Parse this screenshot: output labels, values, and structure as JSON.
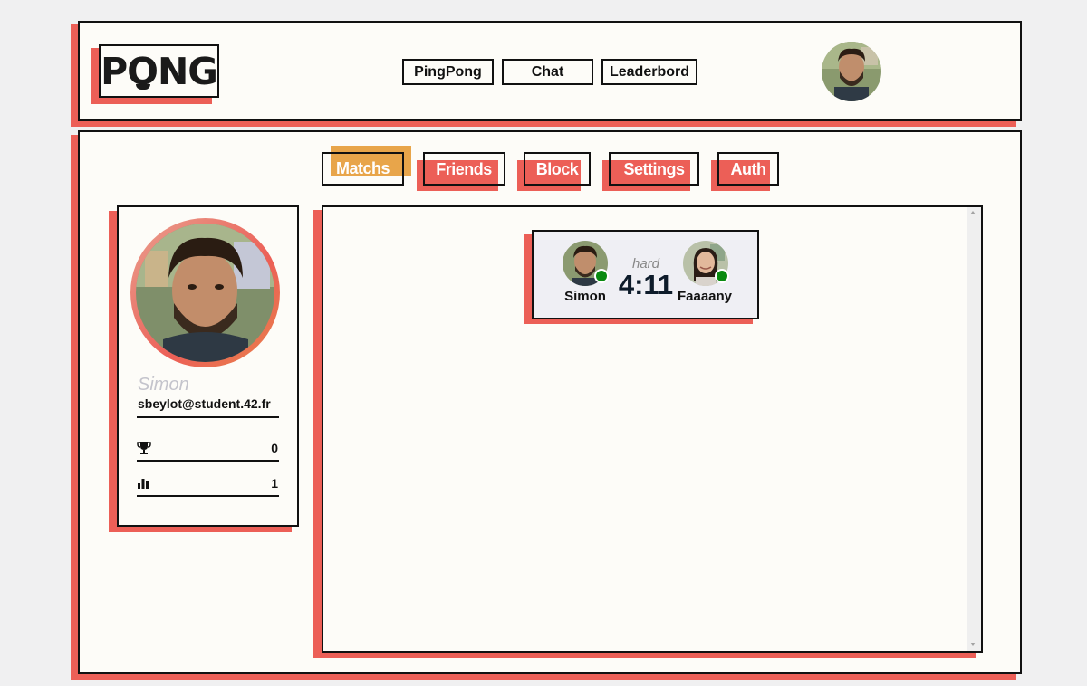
{
  "header": {
    "logo_text": "PONG",
    "nav": [
      {
        "label": "PingPong"
      },
      {
        "label": "Chat"
      },
      {
        "label": "Leaderbord"
      }
    ]
  },
  "tabs": [
    {
      "label": "Matchs",
      "active": true
    },
    {
      "label": "Friends",
      "active": false
    },
    {
      "label": "Block",
      "active": false
    },
    {
      "label": "Settings",
      "active": false
    },
    {
      "label": "Auth",
      "active": false
    }
  ],
  "profile": {
    "name": "Simon",
    "email": "sbeylot@student.42.fr",
    "stats": [
      {
        "icon": "trophy-icon",
        "value": "0"
      },
      {
        "icon": "bar-chart-icon",
        "value": "1"
      }
    ]
  },
  "match": {
    "difficulty": "hard",
    "score": "4:11",
    "player1": "Simon",
    "player2": "Faaaany"
  },
  "colors": {
    "accent_red": "#ec5f57",
    "accent_orange": "#e8a54a",
    "online": "#0a8a10",
    "panel_bg": "#fdfcf8"
  }
}
